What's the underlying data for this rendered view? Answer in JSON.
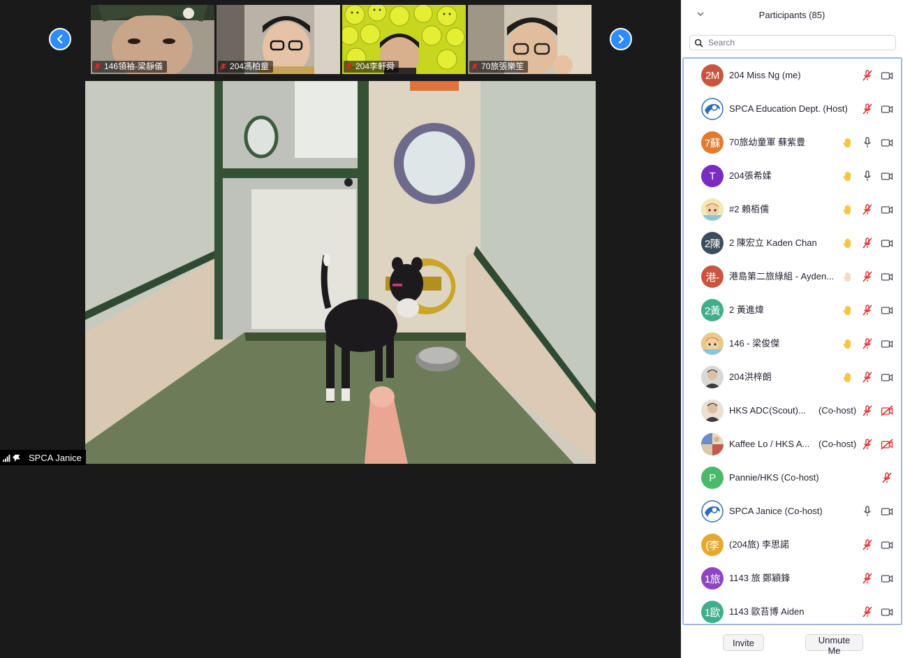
{
  "thumbnails": [
    {
      "label": "146領袖-梁靜儀"
    },
    {
      "label": "204馮柏童"
    },
    {
      "label": "204李軒舜"
    },
    {
      "label": "70旅張樂笙"
    }
  ],
  "active_speaker": {
    "label": "SPCA Janice"
  },
  "panel": {
    "title": "Participants (85)",
    "search_placeholder": "Search",
    "participants": [
      {
        "name": "204 Miss Ng (me)",
        "role": "",
        "avatar_text": "2M",
        "avatar_color": "#c8553d",
        "avatar_icon": "",
        "hand": false,
        "mic": "muted",
        "cam": "on"
      },
      {
        "name": "SPCA Education Dept. (Host)",
        "role": "",
        "avatar_text": "",
        "avatar_color": "#ffffff",
        "avatar_icon": "spca-logo",
        "hand": false,
        "mic": "muted",
        "cam": "on"
      },
      {
        "name": "70旅幼童軍 蘇紫豊",
        "role": "",
        "avatar_text": "7蘇",
        "avatar_color": "#e07b30",
        "avatar_icon": "",
        "hand": true,
        "mic": "on",
        "cam": "on"
      },
      {
        "name": "204張希媃",
        "role": "",
        "avatar_text": "T",
        "avatar_color": "#7a2bc4",
        "avatar_icon": "",
        "hand": true,
        "mic": "on",
        "cam": "on"
      },
      {
        "name": "#2 賴栢儒",
        "role": "",
        "avatar_text": "",
        "avatar_color": "#f3e7b5",
        "avatar_icon": "cartoon-photo",
        "hand": true,
        "mic": "muted",
        "cam": "on"
      },
      {
        "name": "2 陳宏立 Kaden Chan",
        "role": "",
        "avatar_text": "2陳",
        "avatar_color": "#3d4d5e",
        "avatar_icon": "",
        "hand": true,
        "mic": "muted",
        "cam": "on"
      },
      {
        "name": "港島第二旅綠組 - Ayden...",
        "role": "",
        "avatar_text": "港-",
        "avatar_color": "#c8553d",
        "avatar_icon": "",
        "hand": "faded",
        "mic": "muted",
        "cam": "on"
      },
      {
        "name": "2 黃進煒",
        "role": "",
        "avatar_text": "2黃",
        "avatar_color": "#3fae8a",
        "avatar_icon": "",
        "hand": true,
        "mic": "muted",
        "cam": "on"
      },
      {
        "name": "146 - 梁俊傑",
        "role": "",
        "avatar_text": "",
        "avatar_color": "#e8c98a",
        "avatar_icon": "cartoon-photo",
        "hand": true,
        "mic": "muted",
        "cam": "on"
      },
      {
        "name": "204洪梓朗",
        "role": "",
        "avatar_text": "",
        "avatar_color": "#d8d8d8",
        "avatar_icon": "person-photo",
        "hand": true,
        "mic": "muted",
        "cam": "on"
      },
      {
        "name": "HKS ADC(Scout)...",
        "role": "(Co-host)",
        "avatar_text": "",
        "avatar_color": "#e9e1d6",
        "avatar_icon": "person-photo",
        "hand": false,
        "mic": "muted",
        "cam": "off"
      },
      {
        "name": "Kaffee Lo / HKS A...",
        "role": "(Co-host)",
        "avatar_text": "",
        "avatar_color": "#d9c7a8",
        "avatar_icon": "collage-photo",
        "hand": false,
        "mic": "muted",
        "cam": "off"
      },
      {
        "name": "Pannie/HKS (Co-host)",
        "role": "",
        "avatar_text": "P",
        "avatar_color": "#4cb86a",
        "avatar_icon": "",
        "hand": false,
        "mic": "none",
        "cam": "muted-mic-only"
      },
      {
        "name": "SPCA Janice (Co-host)",
        "role": "",
        "avatar_text": "",
        "avatar_color": "#ffffff",
        "avatar_icon": "spca-logo",
        "hand": false,
        "mic": "on",
        "cam": "on"
      },
      {
        "name": "(204旅) 李思諾",
        "role": "",
        "avatar_text": "(李",
        "avatar_color": "#e5a92f",
        "avatar_icon": "",
        "hand": false,
        "mic": "muted",
        "cam": "on"
      },
      {
        "name": "1143 旅 鄭穎鋒",
        "role": "",
        "avatar_text": "1旅",
        "avatar_color": "#8e44c4",
        "avatar_icon": "",
        "hand": false,
        "mic": "muted",
        "cam": "on"
      },
      {
        "name": "1143 歐苔博 Aiden",
        "role": "",
        "avatar_text": "1歐",
        "avatar_color": "#3fae8a",
        "avatar_icon": "",
        "hand": false,
        "mic": "muted",
        "cam": "on"
      }
    ],
    "invite_label": "Invite",
    "unmute_label": "Unmute Me"
  },
  "colors": {
    "accent": "#2d8cff",
    "muted_red": "#e02828",
    "hand_yellow": "#f6c544"
  }
}
